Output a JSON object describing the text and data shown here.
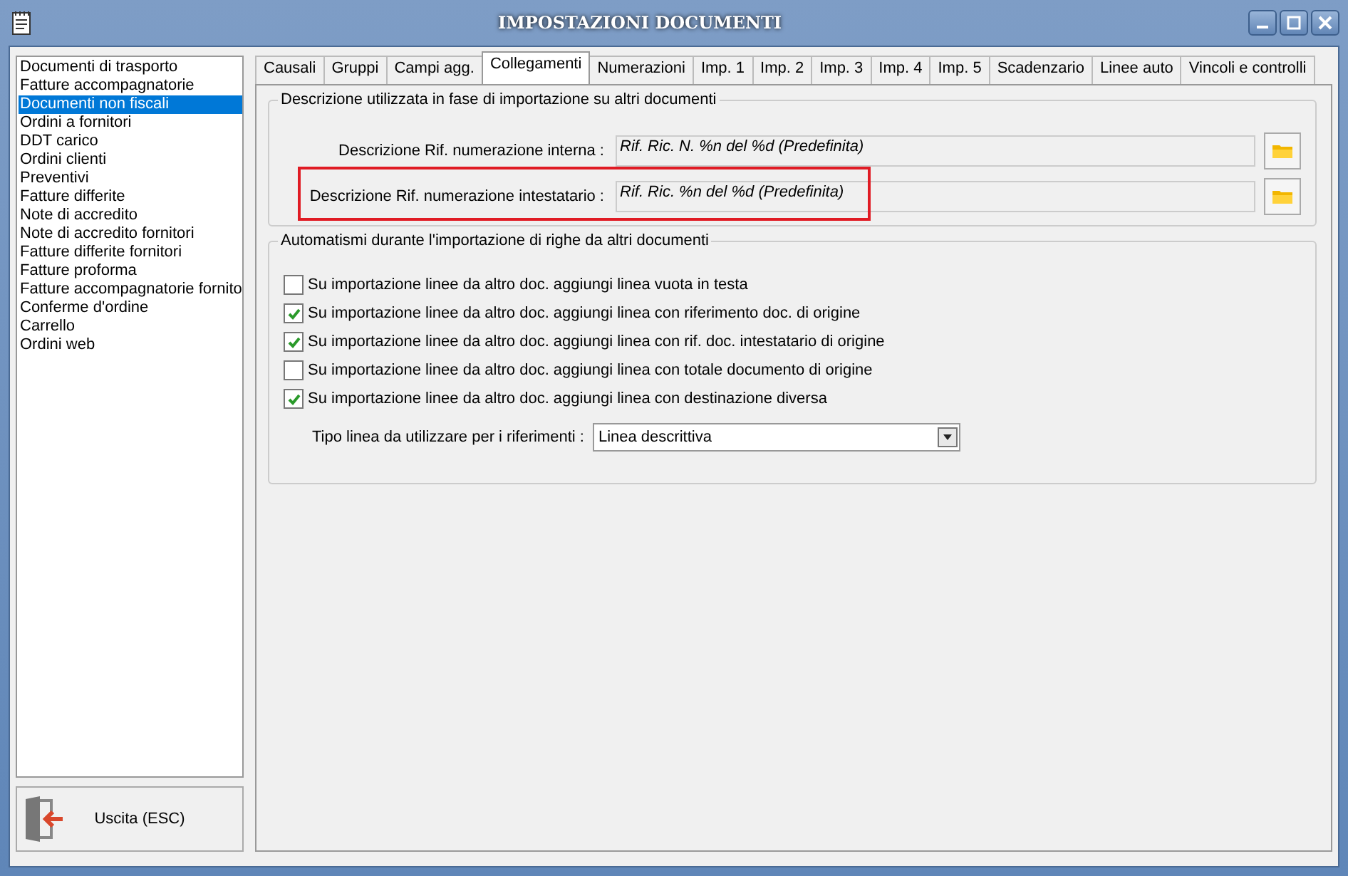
{
  "window": {
    "title": "IMPOSTAZIONI DOCUMENTI"
  },
  "sidebar": {
    "items": [
      {
        "label": "Documenti di trasporto",
        "selected": false
      },
      {
        "label": "Fatture accompagnatorie",
        "selected": false
      },
      {
        "label": "Documenti non fiscali",
        "selected": true
      },
      {
        "label": "Ordini a fornitori",
        "selected": false
      },
      {
        "label": "DDT carico",
        "selected": false
      },
      {
        "label": "Ordini clienti",
        "selected": false
      },
      {
        "label": "Preventivi",
        "selected": false
      },
      {
        "label": "Fatture differite",
        "selected": false
      },
      {
        "label": "Note di accredito",
        "selected": false
      },
      {
        "label": "Note di accredito fornitori",
        "selected": false
      },
      {
        "label": "Fatture differite fornitori",
        "selected": false
      },
      {
        "label": "Fatture proforma",
        "selected": false
      },
      {
        "label": "Fatture accompagnatorie fornito",
        "selected": false
      },
      {
        "label": "Conferme d'ordine",
        "selected": false
      },
      {
        "label": "Carrello",
        "selected": false
      },
      {
        "label": "Ordini web",
        "selected": false
      }
    ]
  },
  "exit_button": {
    "label": "Uscita (ESC)"
  },
  "tabs": [
    {
      "label": "Causali",
      "selected": false
    },
    {
      "label": "Gruppi",
      "selected": false
    },
    {
      "label": "Campi agg.",
      "selected": false
    },
    {
      "label": "Collegamenti",
      "selected": true
    },
    {
      "label": "Numerazioni",
      "selected": false
    },
    {
      "label": "Imp. 1",
      "selected": false
    },
    {
      "label": "Imp. 2",
      "selected": false
    },
    {
      "label": "Imp. 3",
      "selected": false
    },
    {
      "label": "Imp. 4",
      "selected": false
    },
    {
      "label": "Imp. 5",
      "selected": false
    },
    {
      "label": "Scadenzario",
      "selected": false
    },
    {
      "label": "Linee auto",
      "selected": false
    },
    {
      "label": "Vincoli e controlli",
      "selected": false
    }
  ],
  "description_group": {
    "title": "Descrizione utilizzata in fase di importazione su altri documenti",
    "fields": [
      {
        "label": "Descrizione Rif. numerazione interna :",
        "value": "Rif. Ric. N. %n del %d (Predefinita)",
        "highlighted": false
      },
      {
        "label": "Descrizione Rif. numerazione intestatario :",
        "value": "Rif. Ric. %n del %d (Predefinita)",
        "highlighted": true
      }
    ]
  },
  "automation_group": {
    "title": "Automatismi durante l'importazione di righe da altri documenti",
    "options": [
      {
        "label": "Su importazione linee da altro doc. aggiungi linea vuota in testa",
        "checked": false
      },
      {
        "label": "Su importazione linee da altro doc. aggiungi linea con riferimento doc. di origine",
        "checked": true
      },
      {
        "label": "Su importazione linee da altro doc. aggiungi linea con rif. doc. intestatario di origine",
        "checked": true
      },
      {
        "label": "Su importazione linee da altro doc. aggiungi linea con totale documento di origine",
        "checked": false
      },
      {
        "label": "Su importazione linee da altro doc. aggiungi linea con destinazione diversa",
        "checked": true
      }
    ],
    "line_type": {
      "label": "Tipo linea da utilizzare per i riferimenti :",
      "value": "Linea descrittiva"
    }
  }
}
